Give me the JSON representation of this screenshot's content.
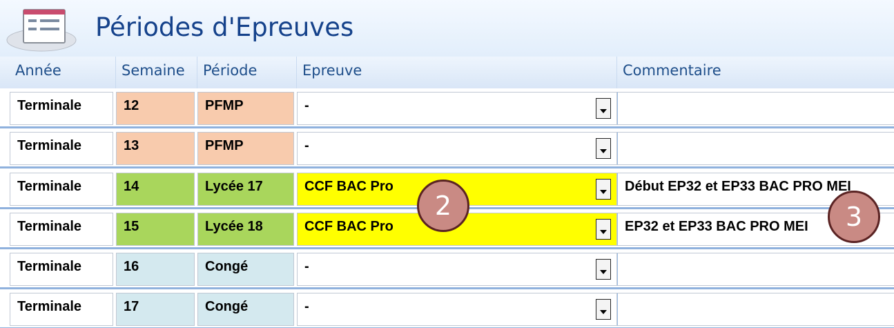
{
  "form": {
    "title": "Périodes d'Epreuves",
    "icon": "form-icon"
  },
  "columns": {
    "annee": "Année",
    "semaine": "Semaine",
    "periode": "Période",
    "epreuve": "Epreuve",
    "commentaire": "Commentaire"
  },
  "rows": [
    {
      "annee": "Terminale",
      "semaine": "12",
      "periode": "PFMP",
      "epreuve": "-",
      "commentaire": "",
      "semaine_color": "#f8cbad",
      "periode_color": "#f8cbad",
      "epreuve_color": "#ffffff"
    },
    {
      "annee": "Terminale",
      "semaine": "13",
      "periode": "PFMP",
      "epreuve": "-",
      "commentaire": "",
      "semaine_color": "#f8cbad",
      "periode_color": "#f8cbad",
      "epreuve_color": "#ffffff"
    },
    {
      "annee": "Terminale",
      "semaine": "14",
      "periode": "Lycée  17",
      "epreuve": "CCF BAC Pro",
      "commentaire": "Début EP32 et EP33 BAC PRO MEI",
      "semaine_color": "#a9d65c",
      "periode_color": "#a9d65c",
      "epreuve_color": "#ffff00"
    },
    {
      "annee": "Terminale",
      "semaine": "15",
      "periode": "Lycée  18",
      "epreuve": "CCF BAC Pro",
      "commentaire": "EP32 et EP33 BAC PRO MEI",
      "semaine_color": "#a9d65c",
      "periode_color": "#a9d65c",
      "epreuve_color": "#ffff00"
    },
    {
      "annee": "Terminale",
      "semaine": "16",
      "periode": "Congé",
      "epreuve": "-",
      "commentaire": "",
      "semaine_color": "#d4e9ef",
      "periode_color": "#d4e9ef",
      "epreuve_color": "#ffffff"
    },
    {
      "annee": "Terminale",
      "semaine": "17",
      "periode": "Congé",
      "epreuve": "-",
      "commentaire": "",
      "semaine_color": "#d4e9ef",
      "periode_color": "#d4e9ef",
      "epreuve_color": "#ffffff"
    }
  ],
  "callouts": [
    {
      "label": "2"
    },
    {
      "label": "3"
    }
  ],
  "colors": {
    "title": "#15428b",
    "header_text": "#1e4e8a",
    "row_border": "#8fb1dd",
    "callout_fill": "#c98a84",
    "callout_border": "#5a2323"
  }
}
